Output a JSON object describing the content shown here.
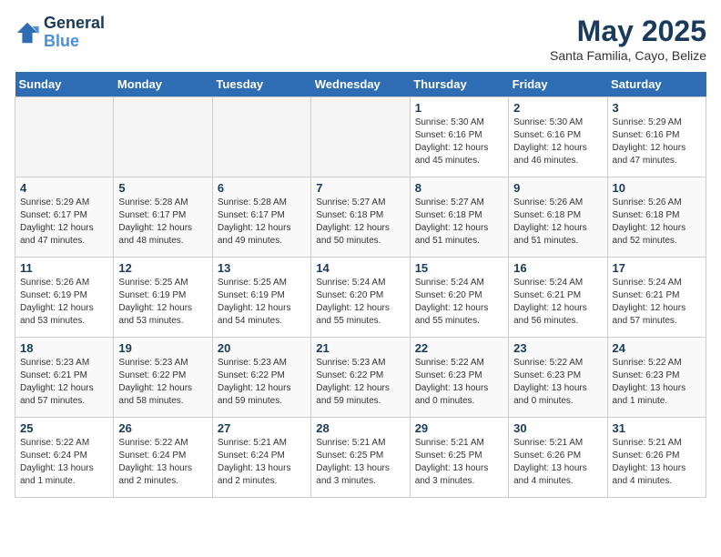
{
  "header": {
    "logo_line1": "General",
    "logo_line2": "Blue",
    "month": "May 2025",
    "location": "Santa Familia, Cayo, Belize"
  },
  "days_of_week": [
    "Sunday",
    "Monday",
    "Tuesday",
    "Wednesday",
    "Thursday",
    "Friday",
    "Saturday"
  ],
  "weeks": [
    [
      {
        "day": "",
        "info": ""
      },
      {
        "day": "",
        "info": ""
      },
      {
        "day": "",
        "info": ""
      },
      {
        "day": "",
        "info": ""
      },
      {
        "day": "1",
        "info": "Sunrise: 5:30 AM\nSunset: 6:16 PM\nDaylight: 12 hours\nand 45 minutes."
      },
      {
        "day": "2",
        "info": "Sunrise: 5:30 AM\nSunset: 6:16 PM\nDaylight: 12 hours\nand 46 minutes."
      },
      {
        "day": "3",
        "info": "Sunrise: 5:29 AM\nSunset: 6:16 PM\nDaylight: 12 hours\nand 47 minutes."
      }
    ],
    [
      {
        "day": "4",
        "info": "Sunrise: 5:29 AM\nSunset: 6:17 PM\nDaylight: 12 hours\nand 47 minutes."
      },
      {
        "day": "5",
        "info": "Sunrise: 5:28 AM\nSunset: 6:17 PM\nDaylight: 12 hours\nand 48 minutes."
      },
      {
        "day": "6",
        "info": "Sunrise: 5:28 AM\nSunset: 6:17 PM\nDaylight: 12 hours\nand 49 minutes."
      },
      {
        "day": "7",
        "info": "Sunrise: 5:27 AM\nSunset: 6:18 PM\nDaylight: 12 hours\nand 50 minutes."
      },
      {
        "day": "8",
        "info": "Sunrise: 5:27 AM\nSunset: 6:18 PM\nDaylight: 12 hours\nand 51 minutes."
      },
      {
        "day": "9",
        "info": "Sunrise: 5:26 AM\nSunset: 6:18 PM\nDaylight: 12 hours\nand 51 minutes."
      },
      {
        "day": "10",
        "info": "Sunrise: 5:26 AM\nSunset: 6:18 PM\nDaylight: 12 hours\nand 52 minutes."
      }
    ],
    [
      {
        "day": "11",
        "info": "Sunrise: 5:26 AM\nSunset: 6:19 PM\nDaylight: 12 hours\nand 53 minutes."
      },
      {
        "day": "12",
        "info": "Sunrise: 5:25 AM\nSunset: 6:19 PM\nDaylight: 12 hours\nand 53 minutes."
      },
      {
        "day": "13",
        "info": "Sunrise: 5:25 AM\nSunset: 6:19 PM\nDaylight: 12 hours\nand 54 minutes."
      },
      {
        "day": "14",
        "info": "Sunrise: 5:24 AM\nSunset: 6:20 PM\nDaylight: 12 hours\nand 55 minutes."
      },
      {
        "day": "15",
        "info": "Sunrise: 5:24 AM\nSunset: 6:20 PM\nDaylight: 12 hours\nand 55 minutes."
      },
      {
        "day": "16",
        "info": "Sunrise: 5:24 AM\nSunset: 6:21 PM\nDaylight: 12 hours\nand 56 minutes."
      },
      {
        "day": "17",
        "info": "Sunrise: 5:24 AM\nSunset: 6:21 PM\nDaylight: 12 hours\nand 57 minutes."
      }
    ],
    [
      {
        "day": "18",
        "info": "Sunrise: 5:23 AM\nSunset: 6:21 PM\nDaylight: 12 hours\nand 57 minutes."
      },
      {
        "day": "19",
        "info": "Sunrise: 5:23 AM\nSunset: 6:22 PM\nDaylight: 12 hours\nand 58 minutes."
      },
      {
        "day": "20",
        "info": "Sunrise: 5:23 AM\nSunset: 6:22 PM\nDaylight: 12 hours\nand 59 minutes."
      },
      {
        "day": "21",
        "info": "Sunrise: 5:23 AM\nSunset: 6:22 PM\nDaylight: 12 hours\nand 59 minutes."
      },
      {
        "day": "22",
        "info": "Sunrise: 5:22 AM\nSunset: 6:23 PM\nDaylight: 13 hours\nand 0 minutes."
      },
      {
        "day": "23",
        "info": "Sunrise: 5:22 AM\nSunset: 6:23 PM\nDaylight: 13 hours\nand 0 minutes."
      },
      {
        "day": "24",
        "info": "Sunrise: 5:22 AM\nSunset: 6:23 PM\nDaylight: 13 hours\nand 1 minute."
      }
    ],
    [
      {
        "day": "25",
        "info": "Sunrise: 5:22 AM\nSunset: 6:24 PM\nDaylight: 13 hours\nand 1 minute."
      },
      {
        "day": "26",
        "info": "Sunrise: 5:22 AM\nSunset: 6:24 PM\nDaylight: 13 hours\nand 2 minutes."
      },
      {
        "day": "27",
        "info": "Sunrise: 5:21 AM\nSunset: 6:24 PM\nDaylight: 13 hours\nand 2 minutes."
      },
      {
        "day": "28",
        "info": "Sunrise: 5:21 AM\nSunset: 6:25 PM\nDaylight: 13 hours\nand 3 minutes."
      },
      {
        "day": "29",
        "info": "Sunrise: 5:21 AM\nSunset: 6:25 PM\nDaylight: 13 hours\nand 3 minutes."
      },
      {
        "day": "30",
        "info": "Sunrise: 5:21 AM\nSunset: 6:26 PM\nDaylight: 13 hours\nand 4 minutes."
      },
      {
        "day": "31",
        "info": "Sunrise: 5:21 AM\nSunset: 6:26 PM\nDaylight: 13 hours\nand 4 minutes."
      }
    ]
  ]
}
